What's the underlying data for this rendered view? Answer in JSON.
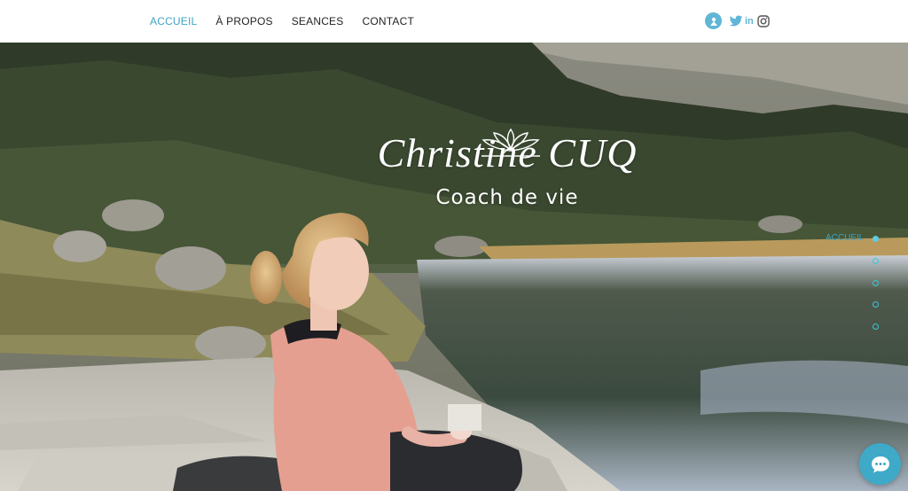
{
  "nav": {
    "items": [
      {
        "label": "ACCUEIL",
        "active": true
      },
      {
        "label": "À PROPOS",
        "active": false
      },
      {
        "label": "SEANCES",
        "active": false
      },
      {
        "label": "CONTACT",
        "active": false
      }
    ],
    "active_color": "#3fa3c3"
  },
  "social": [
    "blue-round-icon",
    "twitter-icon",
    "linkedin-icon",
    "instagram-icon"
  ],
  "hero": {
    "title": "Christine CUQ",
    "subtitle": "Coach de vie"
  },
  "anchor_menu": {
    "active_label": "ACCUEIL",
    "dots": 5
  },
  "chat": {
    "icon": "chat-icon",
    "color": "#3fa9c8"
  }
}
